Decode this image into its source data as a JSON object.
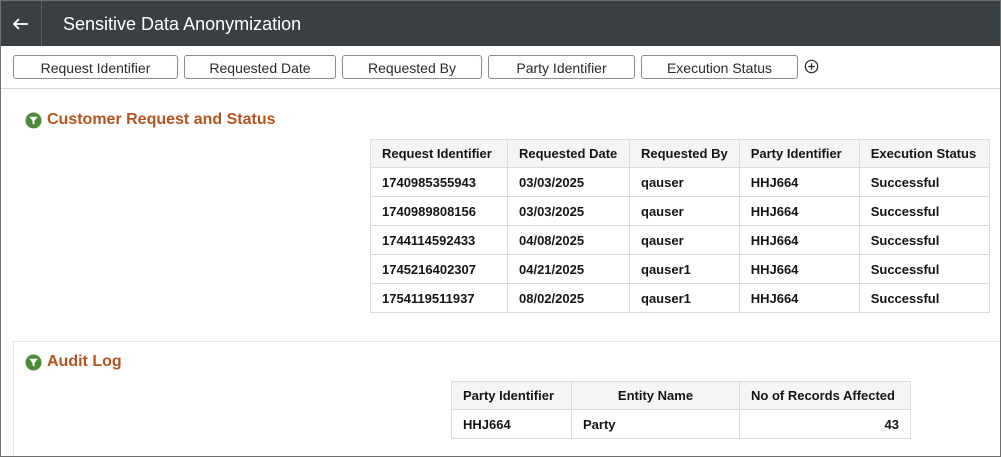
{
  "header": {
    "title": "Sensitive Data Anonymization",
    "back_icon": "arrow-left-icon"
  },
  "filters": [
    {
      "label": "Request Identifier"
    },
    {
      "label": "Requested Date"
    },
    {
      "label": "Requested By"
    },
    {
      "label": "Party Identifier"
    },
    {
      "label": "Execution Status"
    }
  ],
  "colors": {
    "header_bg": "#3a3f44",
    "section_title": "#b5541d",
    "funnel_icon": "#4d8a3a"
  },
  "customer_section": {
    "title": "Customer Request and Status",
    "icon": "filter-funnel-icon",
    "columns": [
      "Request Identifier",
      "Requested Date",
      "Requested By",
      "Party Identifier",
      "Execution Status"
    ],
    "rows": [
      [
        "1740985355943",
        "03/03/2025",
        "qauser",
        "HHJ664",
        "Successful"
      ],
      [
        "1740989808156",
        "03/03/2025",
        "qauser",
        "HHJ664",
        "Successful"
      ],
      [
        "1744114592433",
        "04/08/2025",
        "qauser",
        "HHJ664",
        "Successful"
      ],
      [
        "1745216402307",
        "04/21/2025",
        "qauser1",
        "HHJ664",
        "Successful"
      ],
      [
        "1754119511937",
        "08/02/2025",
        "qauser1",
        "HHJ664",
        "Successful"
      ]
    ]
  },
  "audit_section": {
    "title": "Audit Log",
    "icon": "filter-funnel-icon",
    "columns": [
      "Party Identifier",
      "Entity Name",
      "No of Records Affected"
    ],
    "rows": [
      [
        "HHJ664",
        "Party",
        "43"
      ]
    ]
  }
}
